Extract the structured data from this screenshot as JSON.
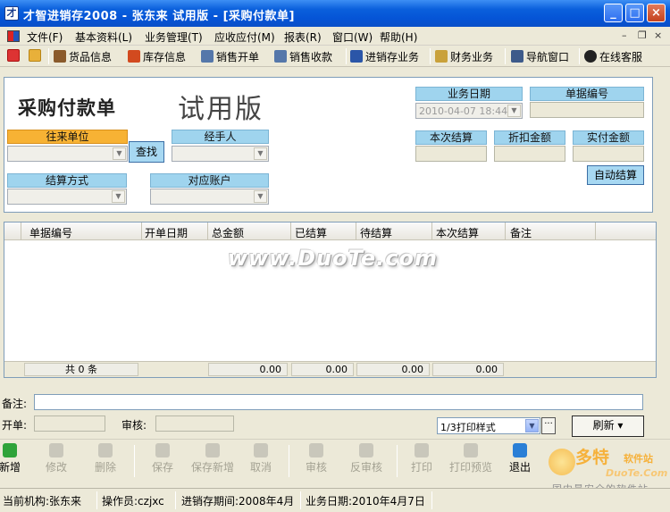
{
  "window": {
    "title": "才智进销存2008 - 张东来 试用版 - [采购付款单]",
    "controls": {
      "minimize": "_",
      "maximize": "□",
      "close": "×"
    }
  },
  "menubar": {
    "items": [
      {
        "label": "文件(F)"
      },
      {
        "label": "基本资料(L)"
      },
      {
        "label": "业务管理(T)"
      },
      {
        "label": "应收应付(M)"
      },
      {
        "label": "报表(R)"
      },
      {
        "label": "窗口(W)"
      },
      {
        "label": "帮助(H)"
      }
    ],
    "mdi_controls": {
      "minimize": "–",
      "restore": "❐",
      "close": "×"
    }
  },
  "toolbar": {
    "items": [
      {
        "label": "货品信息",
        "icon": "goods-icon",
        "color": "#8a5a2b"
      },
      {
        "label": "库存信息",
        "icon": "house-icon",
        "color": "#d24a1f"
      },
      {
        "label": "销售开单",
        "icon": "sales-doc-icon",
        "color": "#5577aa"
      },
      {
        "label": "销售收款",
        "icon": "collect-icon",
        "color": "#5577aa"
      },
      {
        "label": "进销存业务",
        "icon": "business-icon",
        "color": "#2b56a8"
      },
      {
        "label": "财务业务",
        "icon": "finance-icon",
        "color": "#c9a13a"
      },
      {
        "label": "导航窗口",
        "icon": "navigation-icon",
        "color": "#3d5a8a"
      },
      {
        "label": "在线客服",
        "icon": "qq-icon",
        "color": "#222222"
      }
    ]
  },
  "form": {
    "title": "采购付款单",
    "trial_label": "试用版",
    "fields": {
      "partner_label": "往来单位",
      "partner_value": "",
      "find_button": "查找",
      "handler_label": "经手人",
      "handler_value": "",
      "settle_method_label": "结算方式",
      "settle_method_value": "",
      "account_label": "对应账户",
      "account_value": "",
      "biz_date_label": "业务日期",
      "biz_date_value": "2010-04-07 18:44",
      "doc_no_label": "单据编号",
      "doc_no_value": "",
      "this_settle_label": "本次结算",
      "discount_label": "折扣金额",
      "paid_label": "实付金额",
      "auto_settle_button": "自动结算"
    }
  },
  "grid": {
    "columns": [
      "单据编号",
      "开单日期",
      "总金额",
      "已结算",
      "待结算",
      "本次结算",
      "备注"
    ],
    "rows": [],
    "footer": {
      "count_text": "共 0 条",
      "total": "0.00",
      "settled": "0.00",
      "pending": "0.00",
      "this_settle": "0.00"
    },
    "watermark": "www.DuoTe.com"
  },
  "bottom": {
    "remark_label": "备注:",
    "remark_value": "",
    "maker_label": "开单:",
    "maker_value": "",
    "auditor_label": "审核:",
    "auditor_value": "",
    "print_style": "1/3打印样式",
    "ellipsis": "···",
    "refresh_button": "刷新 ▾"
  },
  "actions": [
    {
      "label": "新增",
      "enabled": true
    },
    {
      "label": "修改",
      "enabled": false
    },
    {
      "label": "删除",
      "enabled": false
    },
    {
      "label": "保存",
      "enabled": false
    },
    {
      "label": "保存新增",
      "enabled": false
    },
    {
      "label": "取消",
      "enabled": false
    },
    {
      "label": "审核",
      "enabled": false
    },
    {
      "label": "反审核",
      "enabled": false
    },
    {
      "label": "打印",
      "enabled": false
    },
    {
      "label": "打印预览",
      "enabled": false
    },
    {
      "label": "退出",
      "enabled": true
    }
  ],
  "brand": {
    "big": "多特",
    "small": "软件站",
    "en": "DuoTe.Com",
    "sub": "国内最安全的软件站"
  },
  "statusbar": {
    "org": "当前机构:张东来",
    "operator": "操作员:czjxc",
    "period": "进销存期间:2008年4月",
    "biz_date": "业务日期:2010年4月7日"
  }
}
